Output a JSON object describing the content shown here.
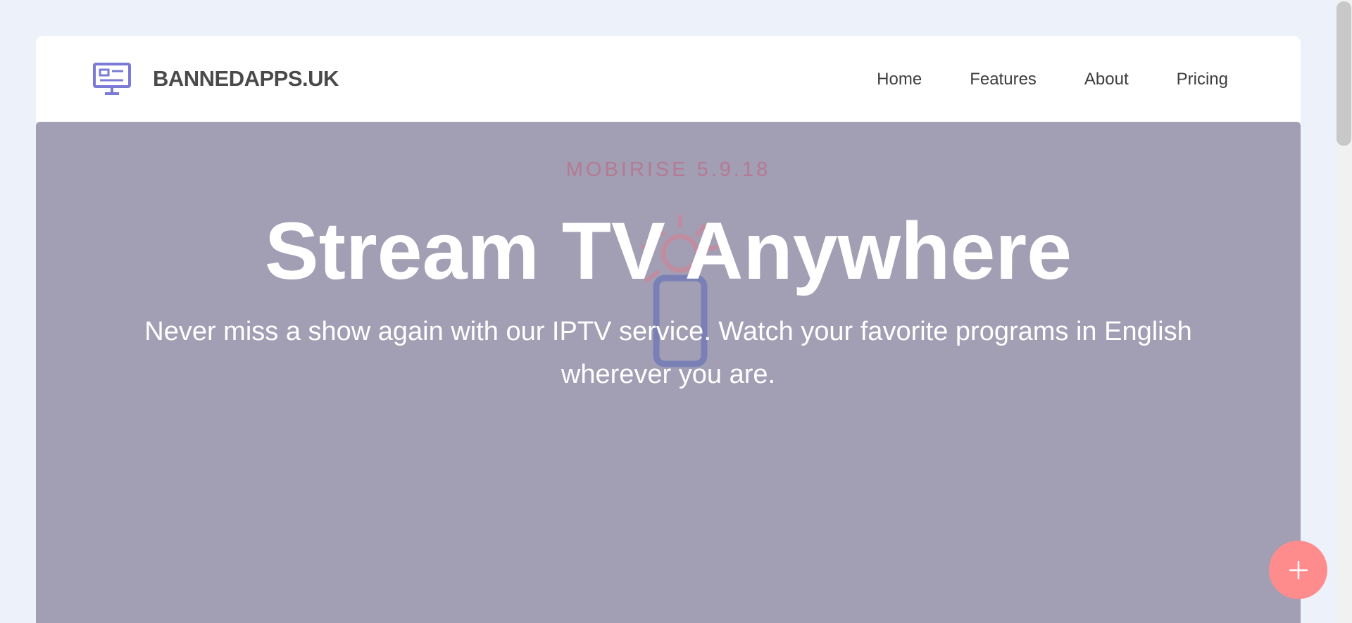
{
  "header": {
    "brand_name": "BANNEDAPPS.UK",
    "brand_icon": "tv-monitor-icon",
    "nav": [
      {
        "label": "Home"
      },
      {
        "label": "Features"
      },
      {
        "label": "About"
      },
      {
        "label": "Pricing"
      }
    ]
  },
  "hero": {
    "label": "MOBIRISE  5.9.18",
    "title": "Stream TV Anywhere",
    "text": "Never miss a show again with our IPTV service. Watch your favorite programs in English wherever you are.",
    "illustration_icon": "phone-lightbulb-icon",
    "background_color": "#a29eb4"
  },
  "fab": {
    "icon": "plus-icon",
    "color": "#ff8c8c"
  },
  "colors": {
    "accent": "#7b7bd6",
    "page_background": "#edf1fa"
  }
}
